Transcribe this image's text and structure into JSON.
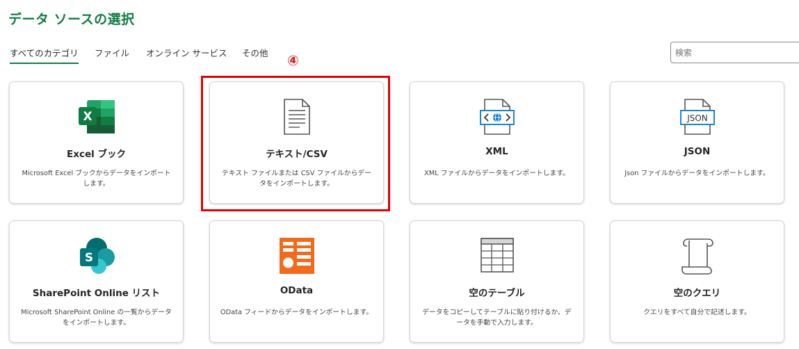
{
  "page": {
    "title": "データ ソースの選択"
  },
  "tabs": [
    {
      "label": "すべてのカテゴリ",
      "active": true
    },
    {
      "label": "ファイル"
    },
    {
      "label": "オンライン サービス"
    },
    {
      "label": "その他"
    }
  ],
  "search": {
    "placeholder": "検索"
  },
  "annotation": {
    "label": "④"
  },
  "cards": [
    {
      "title": "Excel ブック",
      "desc": "Microsoft Excel ブックからデータをインポートします。",
      "icon": "excel-icon"
    },
    {
      "title": "テキスト/CSV",
      "desc": "テキスト ファイルまたは CSV ファイルからデータをインポートします。",
      "icon": "text-file-icon"
    },
    {
      "title": "XML",
      "desc": "XML ファイルからデータをインポートします。",
      "icon": "xml-file-icon"
    },
    {
      "title": "JSON",
      "desc": "Json ファイルからデータをインポートします。",
      "icon": "json-file-icon"
    },
    {
      "title": "SharePoint Online リスト",
      "desc": "Microsoft SharePoint Online の一覧からデータをインポートします。",
      "icon": "sharepoint-icon"
    },
    {
      "title": "OData",
      "desc": "OData フィードからデータをインポートします。",
      "icon": "odata-icon"
    },
    {
      "title": "空のテーブル",
      "desc": "データをコピーしてテーブルに貼り付けるか、データを手動で入力します。",
      "icon": "table-icon"
    },
    {
      "title": "空のクエリ",
      "desc": "クエリをすべて自分で記述します。",
      "icon": "query-scroll-icon"
    }
  ],
  "icon_labels": {
    "excel": "X",
    "sharepoint": "S",
    "json": "JSON"
  },
  "colors": {
    "accent": "#107c41",
    "annotation": "#e00000",
    "odata": "#f26b1d",
    "xml": "#0078d4",
    "sharepoint": "#036c70"
  }
}
